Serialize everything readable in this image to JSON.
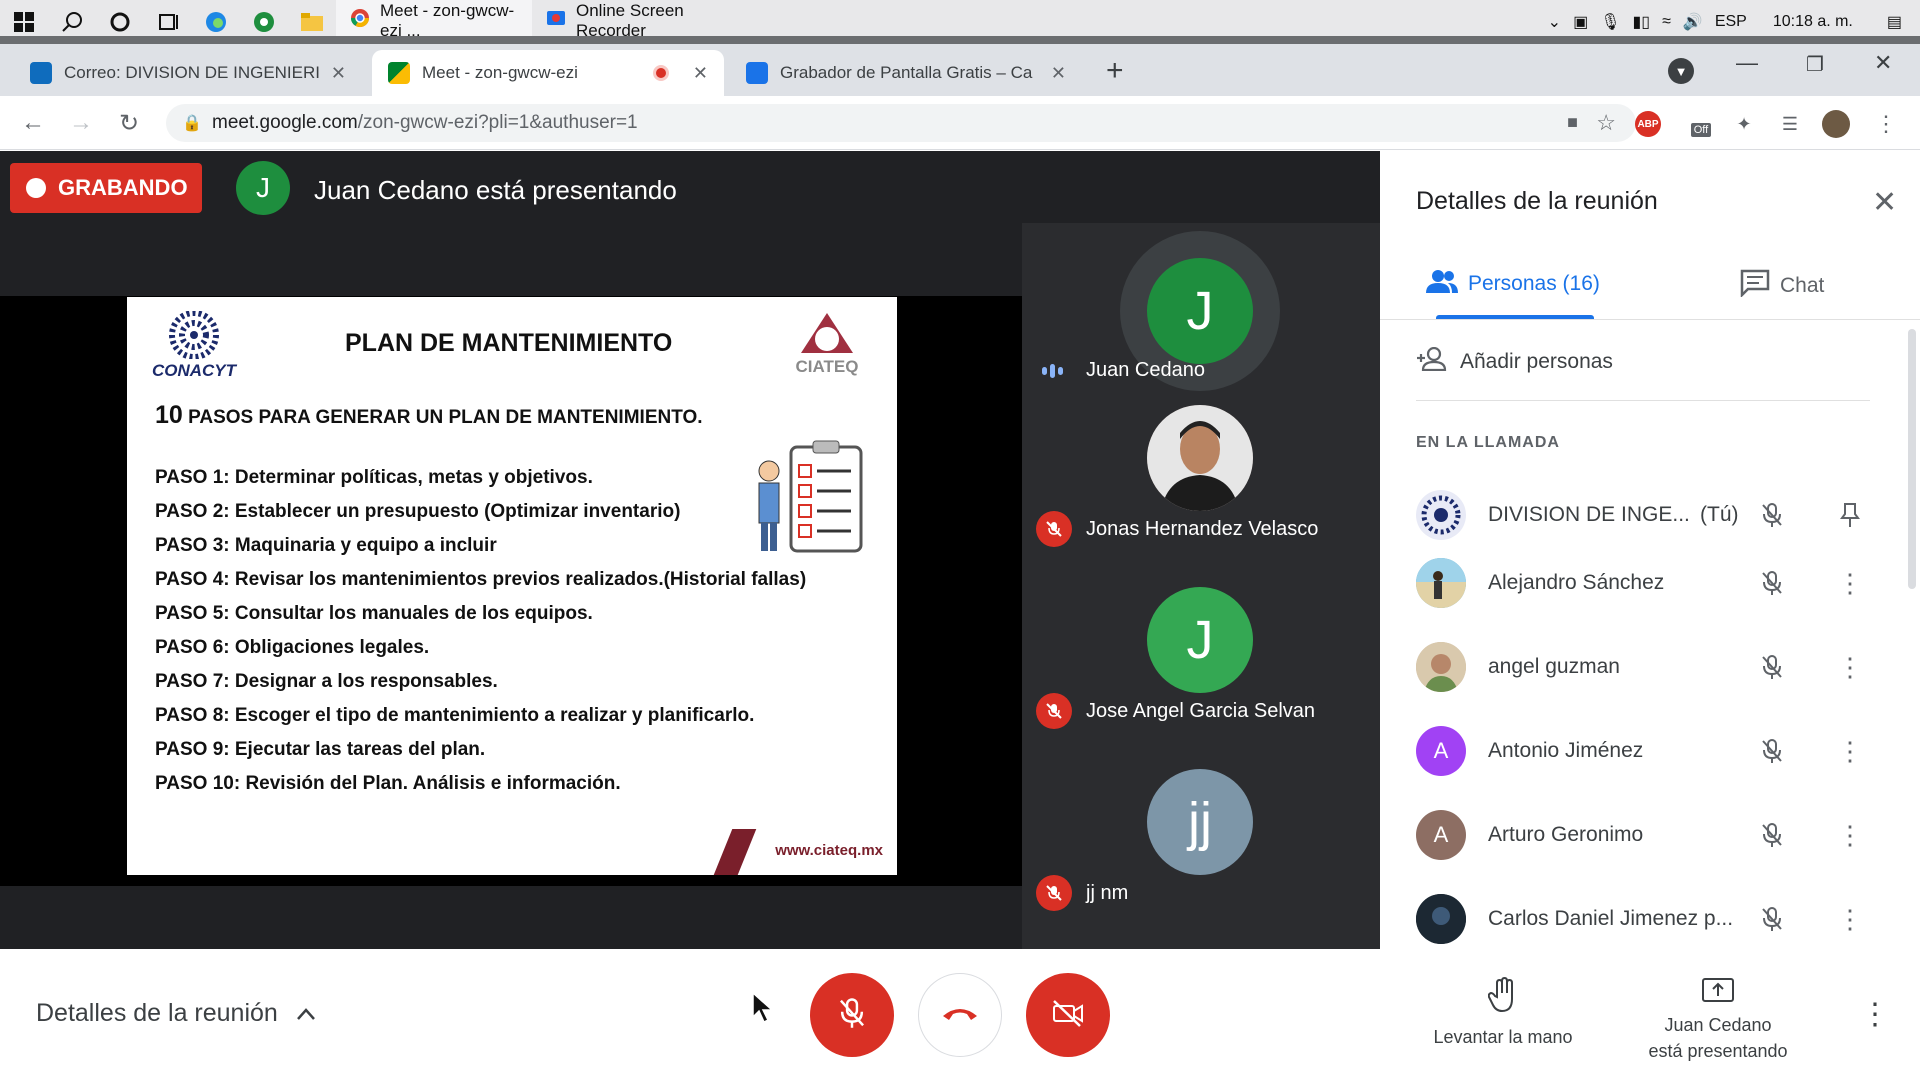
{
  "taskbar": {
    "apps": [
      {
        "label": "Meet - zon-gwcw-ezi ...",
        "icon": "chrome-icon"
      },
      {
        "label": "Online Screen Recorder",
        "icon": "recorder-icon"
      }
    ],
    "tray": {
      "language": "ESP",
      "time": "10:18 a. m."
    }
  },
  "browser": {
    "tabs": [
      {
        "title": "Correo: DIVISION DE INGENIERIA",
        "icon": "outlook-icon"
      },
      {
        "title": "Meet - zon-gwcw-ezi",
        "icon": "meet-icon"
      },
      {
        "title": "Grabador de Pantalla Gratis – Ca",
        "icon": "recorder-icon"
      }
    ],
    "url_host": "meet.google.com",
    "url_path": "/zon-gwcw-ezi?pli=1&authuser=1",
    "ext_abp": "ABP",
    "ext_off": "Off"
  },
  "meet": {
    "recording_label": "GRABANDO",
    "presenter_initial": "J",
    "presenting_text": "Juan Cedano está presentando",
    "slide": {
      "logo_left": "CONACYT",
      "logo_right": "CIATEQ",
      "title": "PLAN DE MANTENIMIENTO",
      "heading_number": "10",
      "heading_text": "PASOS PARA GENERAR UN PLAN DE MANTENIMIENTO.",
      "steps": [
        "PASO 1: Determinar políticas, metas y objetivos.",
        "PASO 2: Establecer un presupuesto (Optimizar inventario)",
        "PASO 3: Maquinaria y equipo a incluir",
        "PASO 4: Revisar los mantenimientos previos realizados.(Historial fallas)",
        "PASO 5: Consultar los manuales de los equipos.",
        "PASO 6: Obligaciones legales.",
        "PASO 7: Designar a los responsables.",
        "PASO 8: Escoger el tipo de mantenimiento a realizar y planificarlo.",
        "PASO 9: Ejecutar las tareas del plan.",
        "PASO 10: Revisión del Plan. Análisis e información."
      ],
      "website": "www.ciateq.mx"
    },
    "tiles": [
      {
        "initial": "J",
        "name": "Juan Cedano",
        "color": "#1e8e3e",
        "muted": false
      },
      {
        "initial": "",
        "name": "Jonas Hernandez Velasco",
        "color": "#5d4037",
        "muted": true
      },
      {
        "initial": "J",
        "name": "Jose Angel Garcia Selvan",
        "color": "#34a853",
        "muted": true
      },
      {
        "initial": "jj",
        "name": "jj nm",
        "color": "#7d96a8",
        "muted": true
      }
    ]
  },
  "panel": {
    "title": "Detalles de la reunión",
    "tab_people": "Personas (16)",
    "tab_chat": "Chat",
    "add_people": "Añadir personas",
    "section": "EN LA LLAMADA",
    "participants": [
      {
        "initial": "",
        "name": "DIVISION DE INGE...",
        "you": "(Tú)",
        "color": "#e8eaf6"
      },
      {
        "initial": "",
        "name": "Alejandro Sánchez",
        "you": "",
        "color": "#4fa3c7"
      },
      {
        "initial": "",
        "name": "angel guzman",
        "you": "",
        "color": "#c9b59a"
      },
      {
        "initial": "A",
        "name": "Antonio Jiménez",
        "you": "",
        "color": "#a142f4"
      },
      {
        "initial": "A",
        "name": "Arturo Geronimo",
        "you": "",
        "color": "#8d6e63"
      },
      {
        "initial": "",
        "name": "Carlos Daniel Jimenez p...",
        "you": "",
        "color": "#263238"
      }
    ]
  },
  "bottom": {
    "details": "Detalles de la reunión",
    "raise_hand": "Levantar la mano",
    "present_line1": "Juan Cedano",
    "present_line2": "está presentando"
  }
}
